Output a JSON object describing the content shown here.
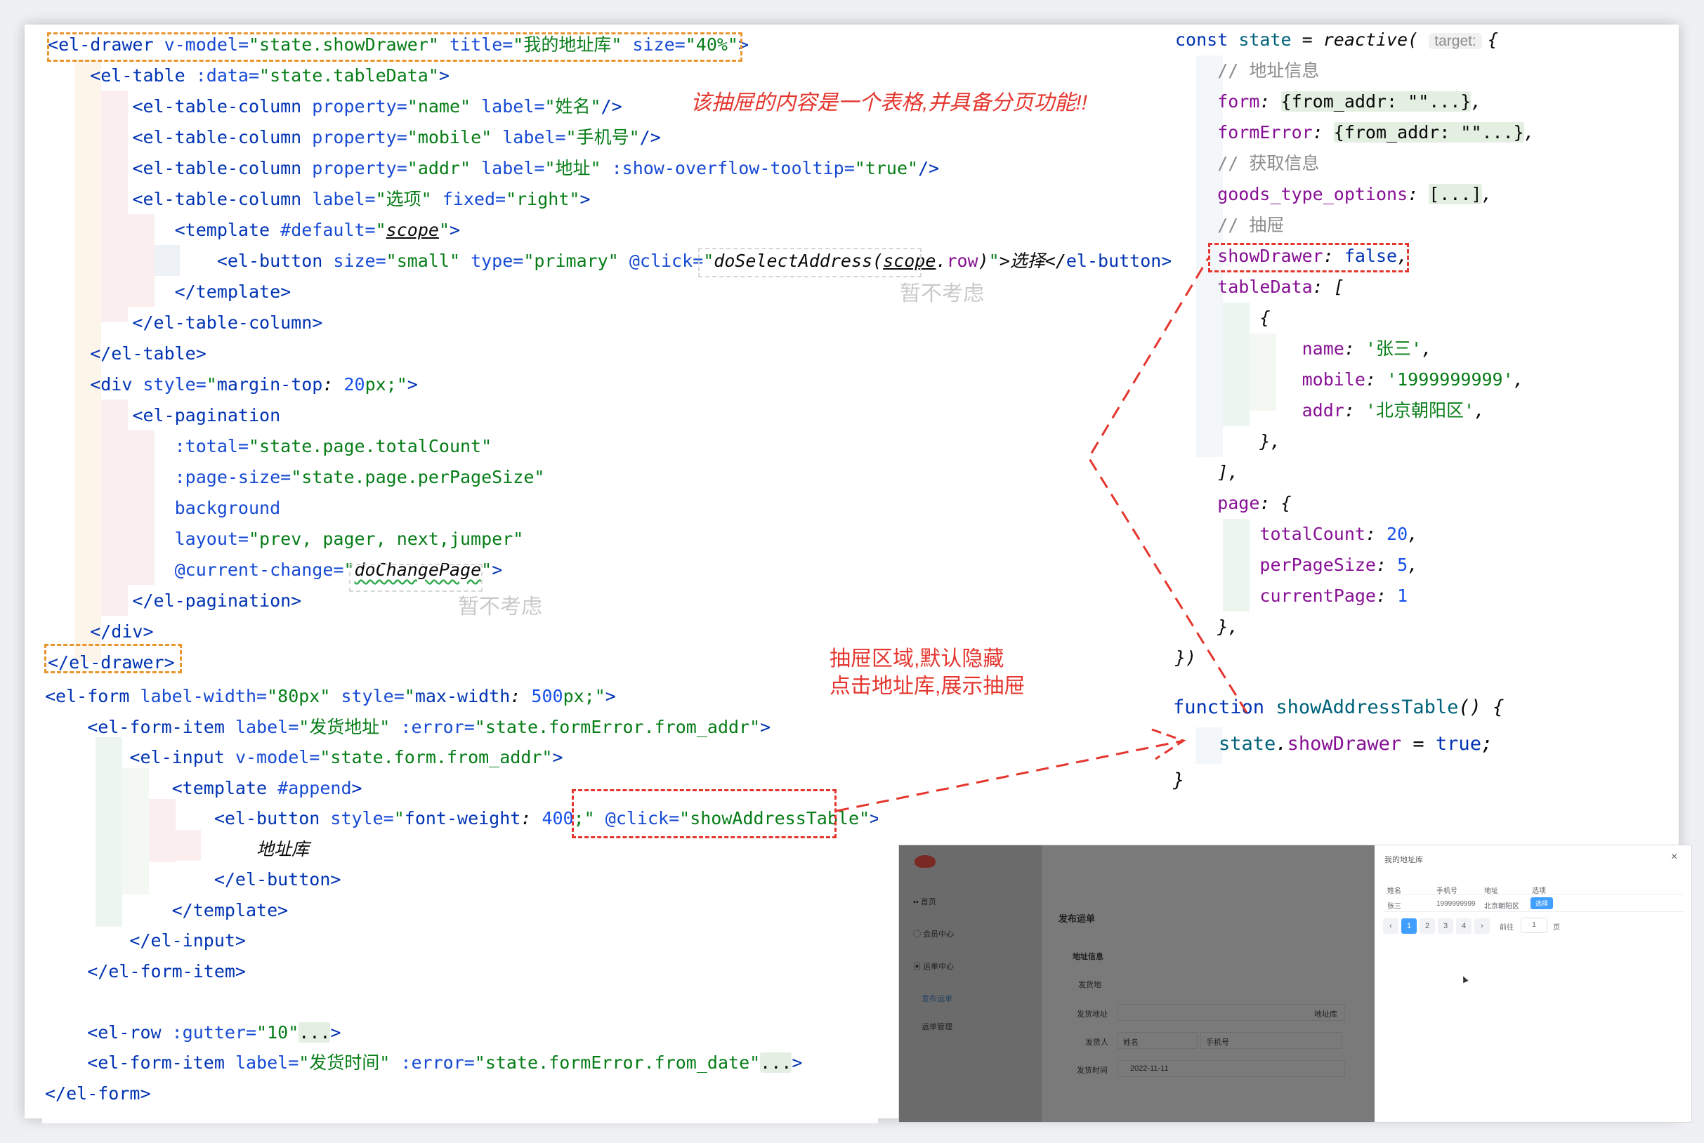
{
  "top_code": {
    "lines": [
      [
        [
          "<",
          "t"
        ],
        [
          "el-drawer",
          "t"
        ],
        [
          " v-model=",
          "a"
        ],
        [
          "\"state.showDrawer\"",
          "s"
        ],
        [
          " title=",
          "a"
        ],
        [
          "\"我的地址库\"",
          "s"
        ],
        [
          " size=",
          "a"
        ],
        [
          "\"40%\"",
          "s"
        ],
        [
          ">",
          "t"
        ]
      ],
      [
        [
          "    <el-table ",
          "t"
        ],
        [
          ":data=",
          "a"
        ],
        [
          "\"state.tableData\"",
          "s"
        ],
        [
          ">",
          "t"
        ]
      ],
      [
        [
          "        <el-table-column ",
          "t"
        ],
        [
          "property=",
          "a"
        ],
        [
          "\"name\"",
          "s"
        ],
        [
          " label=",
          "a"
        ],
        [
          "\"姓名\"",
          "s"
        ],
        [
          "/>",
          "t"
        ]
      ],
      [
        [
          "        <el-table-column ",
          "t"
        ],
        [
          "property=",
          "a"
        ],
        [
          "\"mobile\"",
          "s"
        ],
        [
          " label=",
          "a"
        ],
        [
          "\"手机号\"",
          "s"
        ],
        [
          "/>",
          "t"
        ]
      ],
      [
        [
          "        <el-table-column ",
          "t"
        ],
        [
          "property=",
          "a"
        ],
        [
          "\"addr\"",
          "s"
        ],
        [
          " label=",
          "a"
        ],
        [
          "\"地址\"",
          "s"
        ],
        [
          " :show-overflow-tooltip=",
          "a"
        ],
        [
          "\"true\"",
          "s"
        ],
        [
          "/>",
          "t"
        ]
      ],
      [
        [
          "        <el-table-column ",
          "t"
        ],
        [
          "label=",
          "a"
        ],
        [
          "\"选项\"",
          "s"
        ],
        [
          " fixed=",
          "a"
        ],
        [
          "\"right\"",
          "s"
        ],
        [
          ">",
          "t"
        ]
      ],
      [
        [
          "            <template ",
          "t"
        ],
        [
          "#default=",
          "a"
        ],
        [
          "\"",
          "s"
        ],
        [
          "scope",
          "i u"
        ],
        [
          "\"",
          "s"
        ],
        [
          ">",
          "t"
        ]
      ],
      [
        [
          "                <el-button ",
          "t"
        ],
        [
          "size=",
          "a"
        ],
        [
          "\"small\"",
          "s"
        ],
        [
          " type=",
          "a"
        ],
        [
          "\"primary\"",
          "s"
        ],
        [
          " @click=",
          "a"
        ],
        [
          "\"",
          "s"
        ],
        [
          "doSelectAddress(",
          "i"
        ],
        [
          "scope",
          "i u"
        ],
        [
          ".",
          "i"
        ],
        [
          "row",
          "p"
        ],
        [
          ")",
          "i"
        ],
        [
          "\"",
          "s"
        ],
        [
          ">选择</",
          "i"
        ],
        [
          "el-button",
          "t"
        ],
        [
          ">",
          "t"
        ]
      ],
      [
        [
          "            </template>",
          "t"
        ]
      ],
      [
        [
          "        </el-table-column>",
          "t"
        ]
      ],
      [
        [
          "    </el-table>",
          "t"
        ]
      ],
      [
        [
          "    <div ",
          "t"
        ],
        [
          "style=",
          "a"
        ],
        [
          "\"",
          "s"
        ],
        [
          "margin-top",
          "t"
        ],
        [
          ": ",
          "i"
        ],
        [
          "20",
          "n"
        ],
        [
          "px;",
          "s"
        ],
        [
          "\"",
          "s"
        ],
        [
          ">",
          "t"
        ]
      ],
      [
        [
          "        <el-pagination",
          "t"
        ]
      ],
      [
        [
          "            :total=",
          "a"
        ],
        [
          "\"state.page.totalCount\"",
          "s"
        ]
      ],
      [
        [
          "            :page-size=",
          "a"
        ],
        [
          "\"state.page.perPageSize\"",
          "s"
        ]
      ],
      [
        [
          "            background",
          "a"
        ]
      ],
      [
        [
          "            layout=",
          "a"
        ],
        [
          "\"prev, pager, next,jumper\"",
          "s"
        ]
      ],
      [
        [
          "            @current-change=",
          "a"
        ],
        [
          "\"",
          "s"
        ],
        [
          "doChangePage",
          "i wavy"
        ],
        [
          "\"",
          "s"
        ],
        [
          ">",
          "t"
        ]
      ],
      [
        [
          "        </el-pagination>",
          "t"
        ]
      ],
      [
        [
          "    </div>",
          "t"
        ]
      ],
      [
        [
          "</el-drawer>",
          "t"
        ]
      ]
    ]
  },
  "bottom_code": {
    "lines": [
      [
        [
          "<el-form ",
          "t"
        ],
        [
          "label-width=",
          "a"
        ],
        [
          "\"80px\"",
          "s"
        ],
        [
          " style=",
          "a"
        ],
        [
          "\"",
          "s"
        ],
        [
          "max-width",
          "t"
        ],
        [
          ": ",
          "i"
        ],
        [
          "500",
          "n"
        ],
        [
          "px;",
          "s"
        ],
        [
          "\"",
          "s"
        ],
        [
          ">",
          "t"
        ]
      ],
      [
        [
          "    <el-form-item ",
          "t"
        ],
        [
          "label=",
          "a"
        ],
        [
          "\"发货地址\"",
          "s"
        ],
        [
          " :error=",
          "a"
        ],
        [
          "\"state.formError.from_addr\"",
          "s"
        ],
        [
          ">",
          "t"
        ]
      ],
      [
        [
          "        <el-input ",
          "t"
        ],
        [
          "v-model=",
          "a"
        ],
        [
          "\"state.form.from_addr\"",
          "s"
        ],
        [
          ">",
          "t"
        ]
      ],
      [
        [
          "            <template ",
          "t"
        ],
        [
          "#append",
          "a"
        ],
        [
          ">",
          "t"
        ]
      ],
      [
        [
          "                <el-button ",
          "t"
        ],
        [
          "style=",
          "a"
        ],
        [
          "\"",
          "s"
        ],
        [
          "font-weight",
          "t"
        ],
        [
          ": ",
          "i"
        ],
        [
          "400",
          "n"
        ],
        [
          ";",
          "s"
        ],
        [
          "\" ",
          "s"
        ],
        [
          "@click=",
          "a"
        ],
        [
          "\"showAddressTable\"",
          "s"
        ],
        [
          ">",
          "t"
        ]
      ],
      [
        [
          "                    地址库",
          "i"
        ]
      ],
      [
        [
          "                </el-button>",
          "t"
        ]
      ],
      [
        [
          "            </template>",
          "t"
        ]
      ],
      [
        [
          "        </el-input>",
          "t"
        ]
      ],
      [
        [
          "    </el-form-item>",
          "t"
        ]
      ],
      [
        [
          "",
          "i"
        ]
      ],
      [
        [
          "    <el-row ",
          "t"
        ],
        [
          ":gutter=",
          "a"
        ],
        [
          "\"10\"",
          "s"
        ],
        [
          "...",
          "fold"
        ],
        [
          ">",
          "t"
        ]
      ],
      [
        [
          "    <el-form-item ",
          "t"
        ],
        [
          "label=",
          "a"
        ],
        [
          "\"发货时间\"",
          "s"
        ],
        [
          " :error=",
          "a"
        ],
        [
          "\"state.formError.from_date\"",
          "s"
        ],
        [
          "...",
          "fold"
        ],
        [
          ">",
          "t"
        ]
      ],
      [
        [
          "</el-form>",
          "t"
        ]
      ]
    ]
  },
  "state_code": {
    "lines": [
      [
        [
          "const ",
          "k"
        ],
        [
          "state",
          "f"
        ],
        [
          " = ",
          "i"
        ],
        [
          "reactive",
          "i"
        ],
        [
          "( ",
          "i"
        ],
        [
          "target:",
          "hint"
        ],
        [
          "{",
          "i"
        ]
      ],
      [
        [
          "    // 地址信息",
          "c"
        ]
      ],
      [
        [
          "    form",
          "p"
        ],
        [
          ": ",
          "i"
        ],
        [
          "{from_addr: \"\"...}",
          "fold"
        ],
        [
          ",",
          "i"
        ]
      ],
      [
        [
          "    formError",
          "p"
        ],
        [
          ": ",
          "i"
        ],
        [
          "{from_addr: \"\"...}",
          "fold"
        ],
        [
          ",",
          "i"
        ]
      ],
      [
        [
          "    // 获取信息",
          "c"
        ]
      ],
      [
        [
          "    goods_type_options",
          "p"
        ],
        [
          ": ",
          "i"
        ],
        [
          "[...]",
          "fold"
        ],
        [
          ",",
          "i"
        ]
      ],
      [
        [
          "    // 抽屉",
          "c"
        ]
      ],
      [
        [
          "    showDrawer",
          "p"
        ],
        [
          ": ",
          "i"
        ],
        [
          "false",
          "k"
        ],
        [
          ",",
          "i"
        ]
      ],
      [
        [
          "    tableData",
          "p"
        ],
        [
          ": [",
          "i"
        ]
      ],
      [
        [
          "        {",
          "i"
        ]
      ],
      [
        [
          "            name",
          "p"
        ],
        [
          ": ",
          "i"
        ],
        [
          "'张三'",
          "s"
        ],
        [
          ",",
          "i"
        ]
      ],
      [
        [
          "            mobile",
          "p"
        ],
        [
          ": ",
          "i"
        ],
        [
          "'1999999999'",
          "s"
        ],
        [
          ",",
          "i"
        ]
      ],
      [
        [
          "            addr",
          "p"
        ],
        [
          ": ",
          "i"
        ],
        [
          "'北京朝阳区'",
          "s"
        ],
        [
          ",",
          "i"
        ]
      ],
      [
        [
          "        },",
          "i"
        ]
      ],
      [
        [
          "    ],",
          "i"
        ]
      ],
      [
        [
          "    page",
          "p"
        ],
        [
          ": {",
          "i"
        ]
      ],
      [
        [
          "        totalCount",
          "p"
        ],
        [
          ": ",
          "i"
        ],
        [
          "20",
          "n"
        ],
        [
          ",",
          "i"
        ]
      ],
      [
        [
          "        perPageSize",
          "p"
        ],
        [
          ": ",
          "i"
        ],
        [
          "5",
          "n"
        ],
        [
          ",",
          "i"
        ]
      ],
      [
        [
          "        currentPage",
          "p"
        ],
        [
          ": ",
          "i"
        ],
        [
          "1",
          "n"
        ]
      ],
      [
        [
          "    },",
          "i"
        ]
      ],
      [
        [
          "})",
          "i"
        ]
      ]
    ]
  },
  "func_code": {
    "lines": [
      [
        [
          "function ",
          "k"
        ],
        [
          "showAddressTable",
          "f"
        ],
        [
          "() {",
          "i"
        ]
      ],
      [
        [
          "    state",
          "f"
        ],
        [
          ".",
          "i"
        ],
        [
          "showDrawer",
          "p"
        ],
        [
          " = ",
          "i"
        ],
        [
          "true",
          "k"
        ],
        [
          ";",
          "i"
        ]
      ],
      [
        [
          "}",
          "i"
        ]
      ]
    ]
  },
  "annotations": {
    "drawer_note": "该抽屉的内容是一个表格,并具备分页功能!!",
    "skip_note_1": "暂不考虑",
    "skip_note_2": "暂不考虑",
    "drawer_area_note_1": "抽屉区域,默认隐藏",
    "drawer_area_note_2": "点击地址库,展示抽屉"
  },
  "app_preview": {
    "sidebar": [
      "首页",
      "会员中心",
      "运单中心",
      "发布运单",
      "运单管理"
    ],
    "page_title": "发布运单",
    "section_title": "地址信息",
    "subsection": "发货地",
    "form_labels": [
      "发货地址",
      "发货人",
      "发货时间"
    ],
    "addr_button": "地址库",
    "placeholders": [
      "姓名",
      "手机号"
    ],
    "date_value": "2022-11-11",
    "drawer_title": "我的地址库",
    "close": "×",
    "table_headers": [
      "姓名",
      "手机号",
      "地址",
      "选项"
    ],
    "table_row": [
      "张三",
      "1999999999",
      "北京朝阳区"
    ],
    "select_button": "选择",
    "pages": [
      "1",
      "2",
      "3",
      "4"
    ],
    "prev": "‹",
    "next": "›",
    "goto_label": "前往",
    "goto_value": "1",
    "page_unit": "页"
  },
  "colors": {
    "annotation_red": "#e4362e",
    "drawer_box_orange": "#e9952d",
    "primary_blue": "#409eff"
  }
}
